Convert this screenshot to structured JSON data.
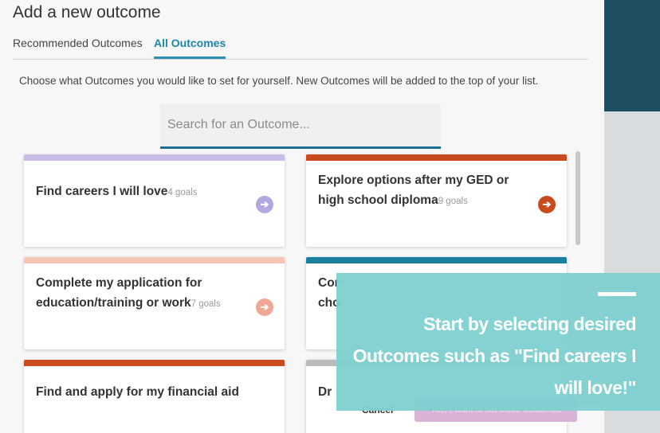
{
  "modal": {
    "title": "Add a new outcome",
    "tabs": [
      {
        "label": "Recommended Outcomes",
        "active": false
      },
      {
        "label": "All Outcomes",
        "active": true
      }
    ],
    "instructions": "Choose what Outcomes you would like to set for yourself. New Outcomes will be added to the top of your list.",
    "search": {
      "placeholder": "Search for an Outcome...",
      "value": ""
    },
    "cards": [
      {
        "title": "Find careers I will love",
        "goals": "4 goals",
        "color": "#c9bde6",
        "arrow_color": "#b3a7df"
      },
      {
        "title": "Explore options after my GED or high school diploma",
        "goals": "9 goals",
        "color": "#c94a1c",
        "arrow_color": "#c94a1c"
      },
      {
        "title": "Complete my application for education/training or work",
        "goals": "7 goals",
        "color": "#f6c5b6",
        "arrow_color": "#f0a793"
      },
      {
        "title": "Cor cho",
        "goals": "",
        "color": "#1d7fa0",
        "arrow_color": ""
      },
      {
        "title": "Find and apply for my financial aid",
        "goals": "",
        "color": "#c94a1c",
        "arrow_color": ""
      },
      {
        "title": "Dr",
        "goals": "",
        "color": "#bbbbbb",
        "arrow_color": ""
      }
    ],
    "cancel_label": "Cancel",
    "add_label": "Yes, I want to set these outcomes"
  },
  "callout": {
    "text": "Start by selecting desired Outcomes such as \"Find careers I will love!\""
  },
  "colors": {
    "accent": "#2b8fb3",
    "backdrop_dark": "#1f4e63",
    "callout": "#7fd0d0"
  }
}
